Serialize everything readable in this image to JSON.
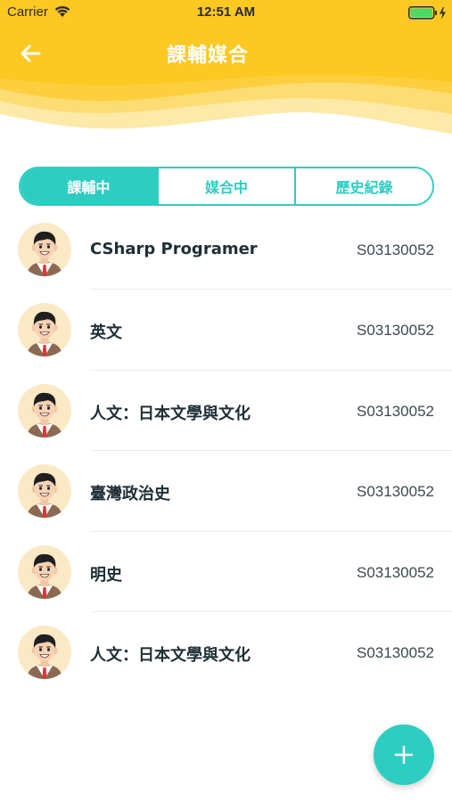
{
  "status_bar": {
    "carrier": "Carrier",
    "time": "12:51 AM"
  },
  "header": {
    "title": "課輔媒合",
    "back_icon": "arrow-left-icon"
  },
  "tabs": [
    {
      "label": "課輔中",
      "active": true
    },
    {
      "label": "媒合中",
      "active": false
    },
    {
      "label": "歷史紀錄",
      "active": false
    }
  ],
  "courses": [
    {
      "name": "CSharp Programer",
      "code": "S03130052"
    },
    {
      "name": "英文",
      "code": "S03130052"
    },
    {
      "name": "人文：日本文學與文化",
      "code": "S03130052"
    },
    {
      "name": "臺灣政治史",
      "code": "S03130052"
    },
    {
      "name": "明史",
      "code": "S03130052"
    },
    {
      "name": "人文：日本文學與文化",
      "code": "S03130052"
    }
  ],
  "fab": {
    "icon": "plus-icon"
  },
  "colors": {
    "header": "#fdc822",
    "accent": "#2ecdc1",
    "avatar_bg": "#fbe9c6"
  }
}
